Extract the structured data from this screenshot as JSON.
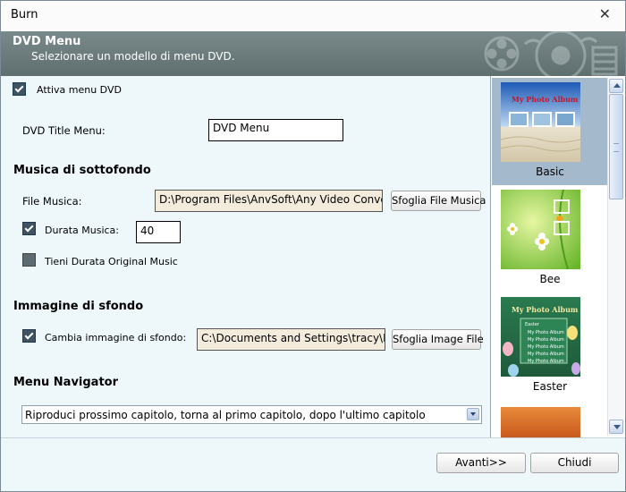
{
  "window": {
    "title": "Burn"
  },
  "header": {
    "title": "DVD Menu",
    "subtitle": "Selezionare un modello di menu DVD."
  },
  "enable_menu": {
    "label": "Attiva menu DVD",
    "checked": true
  },
  "title_menu": {
    "label": "DVD Title Menu:",
    "value": "DVD Menu"
  },
  "music": {
    "section": "Musica di sottofondo",
    "file_label": "File Musica:",
    "file_path": "D:\\Program Files\\AnvSoft\\Any Video Converter",
    "browse_label": "Sfoglia File Musica",
    "duration_label": "Durata Musica:",
    "duration_checked": true,
    "duration_value": "40",
    "keep_original_label": "Tieni Durata Original Music",
    "keep_original_checked": false
  },
  "background": {
    "section": "Immagine di sfondo",
    "change_label": "Cambia immagine di sfondo:",
    "change_checked": true,
    "path": "C:\\Documents and Settings\\tracy\\My Documents",
    "browse_label": "Sfoglia Image File"
  },
  "navigator": {
    "section": "Menu Navigator",
    "selected": "Riproduci prossimo capitolo, torna al primo capitolo, dopo l'ultimo capitolo"
  },
  "templates": [
    {
      "name": "Basic",
      "thumb_text": "My Photo Album",
      "selected": true
    },
    {
      "name": "Bee",
      "thumb_text": "",
      "selected": false
    },
    {
      "name": "Easter",
      "thumb_text": "My Photo Album",
      "menu_title": "Easter",
      "menu_items": [
        "My Photo Album",
        "My Photo Album",
        "My Photo Album",
        "My Photo Album",
        "My Photo Album"
      ],
      "selected": false
    }
  ],
  "footer": {
    "next_label": "Avanti>>",
    "close_label": "Chiudi"
  },
  "colors": {
    "header": "#6b7b7c",
    "content_bg": "#eef8fb",
    "selection": "#a5b9cc"
  },
  "icons": {
    "close": "close-icon",
    "film": "film-reel-icon",
    "disc": "dvd-disc-icon"
  }
}
